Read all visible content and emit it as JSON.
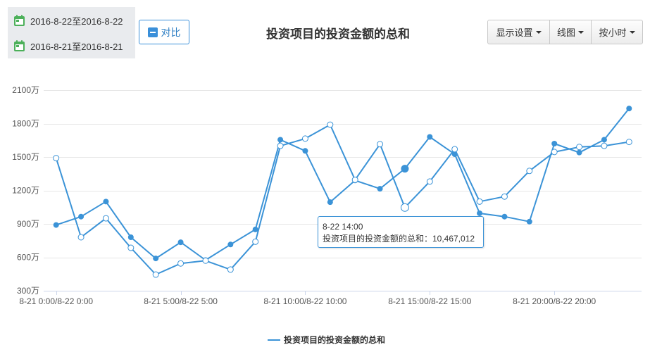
{
  "date_ranges": [
    {
      "icon": "calendar-icon",
      "label": "2016-8-22至2016-8-22"
    },
    {
      "icon": "calendar-icon",
      "label": "2016-8-21至2016-8-21"
    }
  ],
  "compare_button": {
    "icon": "minus-square-icon",
    "label": "对比"
  },
  "toolbar": {
    "display_settings": {
      "label": "显示设置",
      "icon": "caret-down-icon"
    },
    "chart_type": {
      "label": "线图",
      "icon": "caret-down-icon"
    },
    "granularity": {
      "label": "按小时",
      "icon": "caret-down-icon"
    }
  },
  "colors": {
    "series": "#3b93d7",
    "accent": "#3a8fd9",
    "calendar": "#4cb05a",
    "panel_background": "#e9ebee"
  },
  "chart_data": {
    "type": "line",
    "title": "投资项目的投资金额的总和",
    "x": [
      0,
      1,
      2,
      3,
      4,
      5,
      6,
      7,
      8,
      9,
      10,
      11,
      12,
      13,
      14,
      15,
      16,
      17,
      18,
      19,
      20,
      21,
      22,
      23
    ],
    "x_ticks": [
      {
        "x": 0,
        "label": "8-21 0:00/8-22 0:00"
      },
      {
        "x": 5,
        "label": "8-21 5:00/8-22 5:00"
      },
      {
        "x": 10,
        "label": "8-21 10:00/8-22 10:00"
      },
      {
        "x": 15,
        "label": "8-21 15:00/8-22 15:00"
      },
      {
        "x": 20,
        "label": "8-21 20:00/8-22 20:00"
      }
    ],
    "ylim": [
      300,
      2100
    ],
    "y_ticks": [
      {
        "value": 300,
        "label": "300万"
      },
      {
        "value": 600,
        "label": "600万"
      },
      {
        "value": 900,
        "label": "900万"
      },
      {
        "value": 1200,
        "label": "1200万"
      },
      {
        "value": 1500,
        "label": "1500万"
      },
      {
        "value": 1800,
        "label": "1800万"
      },
      {
        "value": 2100,
        "label": "2100万"
      }
    ],
    "grid": true,
    "legend": {
      "label": "投资项目的投资金额的总和",
      "position": "bottom-center"
    },
    "series": [
      {
        "hollow_markers": false,
        "values": [
          890,
          965,
          1100,
          780,
          590,
          735,
          575,
          715,
          850,
          1655,
          1555,
          1095,
          1290,
          1215,
          1395,
          1680,
          1525,
          995,
          965,
          920,
          1620,
          1540,
          1655,
          1935
        ]
      },
      {
        "hollow_markers": true,
        "values": [
          1490,
          780,
          950,
          685,
          445,
          545,
          570,
          490,
          740,
          1600,
          1665,
          1790,
          1295,
          1615,
          1046.7,
          1280,
          1570,
          1100,
          1145,
          1375,
          1545,
          1590,
          1600,
          1635
        ]
      }
    ],
    "tooltip": {
      "x": 14,
      "series": 1,
      "header": "8-22 14:00",
      "body": "投资项目的投资金额的总和：10,467,012"
    }
  }
}
